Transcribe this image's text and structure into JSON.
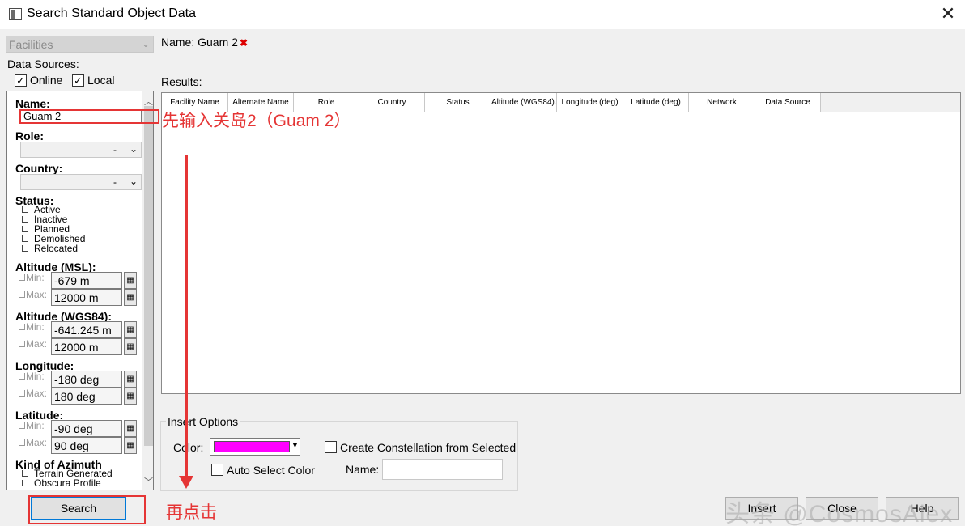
{
  "window": {
    "title": "Search Standard Object Data",
    "close_glyph": "✕"
  },
  "category": {
    "value": "Facilities"
  },
  "data_sources": {
    "label": "Data Sources:",
    "online": {
      "label": "Online",
      "checked": true
    },
    "local": {
      "label": "Local",
      "checked": true
    }
  },
  "criteria": {
    "name_label": "Name:",
    "name_value": "Guam 2",
    "role_label": "Role:",
    "role_value": "-",
    "country_label": "Country:",
    "country_value": "-",
    "status_label": "Status:",
    "status_items": [
      "Active",
      "Inactive",
      "Planned",
      "Demolished",
      "Relocated"
    ],
    "alt_msl_label": "Altitude (MSL):",
    "alt_msl_min": "-679 m",
    "alt_msl_max": "12000 m",
    "alt_wgs_label": "Altitude (WGS84):",
    "alt_wgs_min": "-641.245 m",
    "alt_wgs_max": "12000 m",
    "lon_label": "Longitude:",
    "lon_min": "-180 deg",
    "lon_max": "180 deg",
    "lat_label": "Latitude:",
    "lat_min": "-90 deg",
    "lat_max": "90 deg",
    "min_label": "Min:",
    "max_label": "Max:",
    "azimuth_label": "Kind of Azimuth",
    "azimuth_items": [
      "Terrain Generated",
      "Obscura Profile"
    ]
  },
  "results": {
    "name_header": "Name: Guam 2",
    "label": "Results:",
    "columns": [
      "Facility Name",
      "Alternate Name",
      "Role",
      "Country",
      "Status",
      "Altitude (WGS84)...",
      "Longitude (deg)",
      "Latitude (deg)",
      "Network",
      "Data Source"
    ]
  },
  "insert_options": {
    "title": "Insert Options",
    "color_label": "Color:",
    "color_value": "#ff00ff",
    "auto_select_label": "Auto Select Color",
    "constellation_label": "Create Constellation from Selected",
    "name_label": "Name:"
  },
  "buttons": {
    "search": "Search",
    "insert": "Insert",
    "close": "Close",
    "help": "Help"
  },
  "annotations": {
    "step1": "先输入关岛2（Guam 2）",
    "step2": "再点击",
    "color": "#e53535"
  },
  "watermark": "头条 @CosmosAlex"
}
